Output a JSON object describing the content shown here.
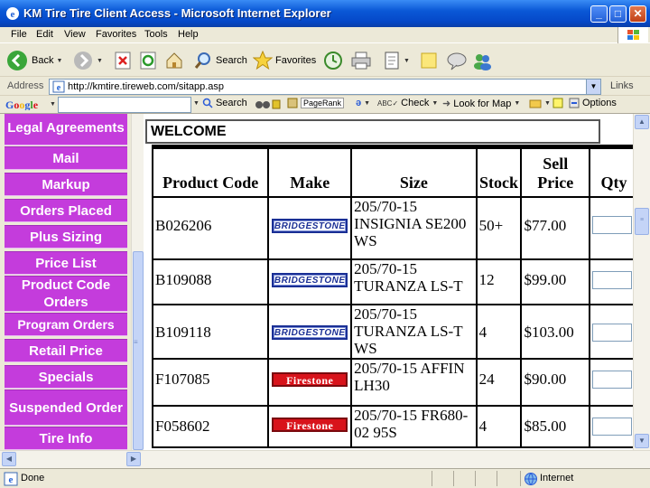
{
  "window": {
    "title": "KM Tire Tire Client Access - Microsoft Internet Explorer",
    "minimize": "_",
    "maximize": "□",
    "close": "✕"
  },
  "menu": [
    "File",
    "Edit",
    "View",
    "Favorites",
    "Tools",
    "Help"
  ],
  "toolbar": {
    "back": "Back",
    "search": "Search",
    "favorites": "Favorites"
  },
  "address": {
    "label": "Address",
    "url": "http://kmtire.tireweb.com/sitapp.asp",
    "links": "Links"
  },
  "google": {
    "search": "Search",
    "pagerank": "PageRank",
    "check": "Check",
    "lookup": "Look for Map",
    "options": "Options"
  },
  "sidebar": {
    "items": [
      "Legal Agreements",
      "Mail",
      "Markup",
      "Orders Placed",
      "Plus Sizing",
      "Price List",
      "Product Code Orders",
      "Program Orders",
      "Retail Price",
      "Specials",
      "Suspended Order",
      "Tire Info"
    ]
  },
  "main": {
    "welcome": "WELCOME",
    "columns": [
      "Product Code",
      "Make",
      "Size",
      "Stock",
      "Sell Price",
      "Qty"
    ],
    "rows": [
      {
        "code": "B026206",
        "make": "BRIDGESTONE",
        "size": "205/70-15 INSIGNIA SE200 WS",
        "stock": "50+",
        "price": "$77.00"
      },
      {
        "code": "B109088",
        "make": "BRIDGESTONE",
        "size": "205/70-15 TURANZA LS-T",
        "stock": "12",
        "price": "$99.00"
      },
      {
        "code": "B109118",
        "make": "BRIDGESTONE",
        "size": "205/70-15 TURANZA LS-T WS",
        "stock": "4",
        "price": "$103.00"
      },
      {
        "code": "F107085",
        "make": "Firestone",
        "size": "205/70-15 AFFIN LH30",
        "stock": "24",
        "price": "$90.00"
      },
      {
        "code": "F058602",
        "make": "Firestone",
        "size": "205/70-15 FR680-02 95S",
        "stock": "4",
        "price": "$85.00"
      }
    ]
  },
  "status": {
    "text": "Done",
    "zone": "Internet"
  },
  "colors": {
    "nav": "#c43cdc",
    "bridgestone": "#1a2f95",
    "firestone": "#d8131b"
  }
}
